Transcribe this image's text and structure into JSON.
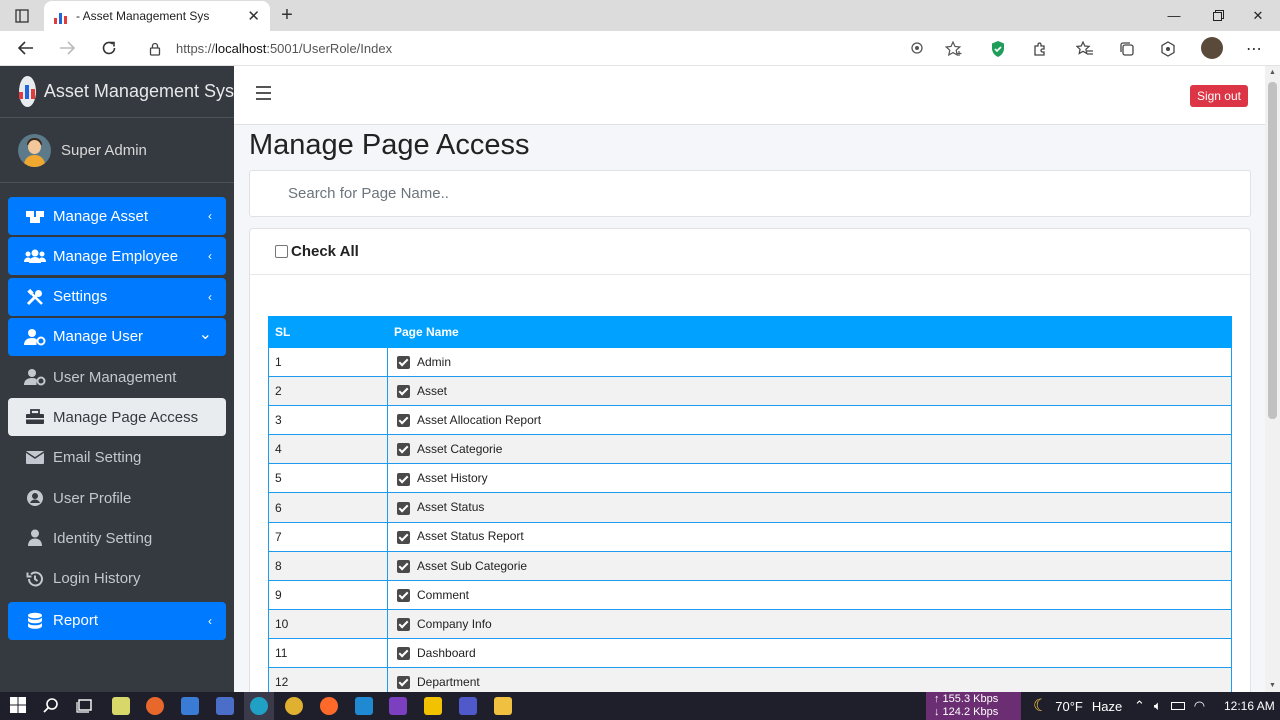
{
  "browser": {
    "tab_title": "- Asset Management Sys",
    "tab_close": "✕",
    "new_tab": "+",
    "url_scheme": "https://",
    "url_host": "localhost",
    "url_path": ":5001/UserRole/Index"
  },
  "sidebar": {
    "brand": "Asset Management Sys",
    "user_name": "Super Admin",
    "items": [
      {
        "label": "Manage Asset",
        "icon": "boxes-icon",
        "style": "primary",
        "arrow": "‹"
      },
      {
        "label": "Manage Employee",
        "icon": "users-icon",
        "style": "primary",
        "arrow": "‹"
      },
      {
        "label": "Settings",
        "icon": "tools-icon",
        "style": "primary",
        "arrow": "‹"
      },
      {
        "label": "Manage User",
        "icon": "user-cog-icon",
        "style": "primary",
        "arrow": "⌄"
      },
      {
        "label": "User Management",
        "icon": "user-cog-icon",
        "style": "sub"
      },
      {
        "label": "Manage Page Access",
        "icon": "toolbox-icon",
        "style": "active"
      },
      {
        "label": "Email Setting",
        "icon": "envelope-icon",
        "style": "sub"
      },
      {
        "label": "User Profile",
        "icon": "user-circle-icon",
        "style": "sub"
      },
      {
        "label": "Identity Setting",
        "icon": "user-shield-icon",
        "style": "sub"
      },
      {
        "label": "Login History",
        "icon": "history-icon",
        "style": "sub"
      },
      {
        "label": "Report",
        "icon": "database-icon",
        "style": "primary",
        "arrow": "‹"
      }
    ]
  },
  "header": {
    "sign_out": "Sign out"
  },
  "main": {
    "title": "Manage Page Access",
    "search_placeholder": "Search for Page Name..",
    "check_all_label": "Check All",
    "table": {
      "headers": [
        "SL",
        "Page Name"
      ],
      "rows": [
        {
          "sl": "1",
          "name": "Admin",
          "checked": true
        },
        {
          "sl": "2",
          "name": "Asset",
          "checked": true
        },
        {
          "sl": "3",
          "name": "Asset Allocation Report",
          "checked": true
        },
        {
          "sl": "4",
          "name": "Asset Categorie",
          "checked": true
        },
        {
          "sl": "5",
          "name": "Asset History",
          "checked": true
        },
        {
          "sl": "6",
          "name": "Asset Status",
          "checked": true
        },
        {
          "sl": "7",
          "name": "Asset Status Report",
          "checked": true
        },
        {
          "sl": "8",
          "name": "Asset Sub Categorie",
          "checked": true
        },
        {
          "sl": "9",
          "name": "Comment",
          "checked": true
        },
        {
          "sl": "10",
          "name": "Company Info",
          "checked": true
        },
        {
          "sl": "11",
          "name": "Dashboard",
          "checked": true
        },
        {
          "sl": "12",
          "name": "Department",
          "checked": true
        }
      ]
    }
  },
  "taskbar": {
    "net_up": "↑ 155.3 Kbps",
    "net_down": "↓ 124.2 Kbps",
    "temperature": "70°F",
    "weather": "Haze",
    "time": "12:16 AM"
  },
  "colors": {
    "primary": "#007bff",
    "sidebar_bg": "#343a40",
    "table_header": "#00a1ff",
    "danger": "#dc3545"
  }
}
